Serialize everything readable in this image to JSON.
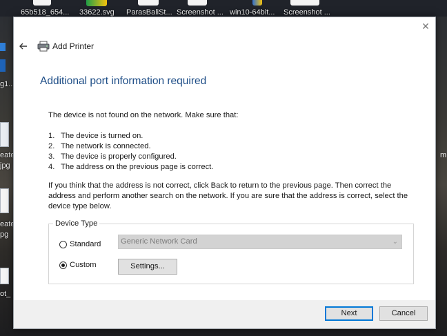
{
  "desktop": {
    "top_icons": [
      {
        "label": "65b518_654..."
      },
      {
        "label": "33622.svg"
      },
      {
        "label": "ParasBaliSt..."
      },
      {
        "label": "Screenshot ..."
      },
      {
        "label": "win10-64bit..."
      },
      {
        "label": "Screenshot ..."
      }
    ],
    "left_labels": [
      "g1...",
      "eate",
      "jpg",
      "eate",
      "pg",
      "ot_"
    ],
    "right_label": "m"
  },
  "dialog": {
    "title": "Add Printer",
    "heading": "Additional port information required",
    "intro": "The device is not found on the network. Make sure that:",
    "steps": [
      {
        "num": "1.",
        "text": "The device is turned on."
      },
      {
        "num": "2.",
        "text": "The network is connected."
      },
      {
        "num": "3.",
        "text": "The device is properly configured."
      },
      {
        "num": "4.",
        "text": "The address on the previous page is correct."
      }
    ],
    "help_text": "If you think that the address is not correct, click Back to return to the previous page. Then correct the address and perform another search on the network. If you are sure that the address is correct, select the device type below.",
    "device_type": {
      "legend": "Device Type",
      "standard_label": "Standard",
      "standard_selected": false,
      "standard_value": "Generic Network Card",
      "custom_label": "Custom",
      "custom_selected": true,
      "settings_label": "Settings..."
    },
    "buttons": {
      "next": "Next",
      "cancel": "Cancel"
    }
  },
  "colors": {
    "accent": "#0078d7",
    "heading": "#1c4c86",
    "footer": "#f0f0f0"
  }
}
